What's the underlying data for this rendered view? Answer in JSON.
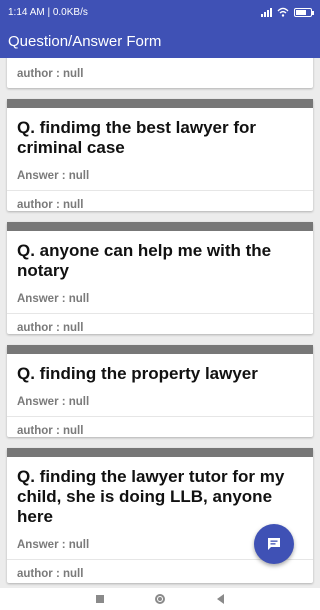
{
  "status_bar": {
    "time_info": "1:14 AM | 0.0KB/s",
    "battery_level": 0.6
  },
  "app_bar": {
    "title": "Question/Answer Form"
  },
  "top_partial_card": {
    "author": "author : null"
  },
  "cards": [
    {
      "question": "Q. findimg the best lawyer for criminal case",
      "answer": "Answer : null",
      "author": "author : null"
    },
    {
      "question": "Q. anyone can help me with the notary",
      "answer": "Answer : null",
      "author": "author : null"
    },
    {
      "question": "Q. finding the property lawyer",
      "answer": "Answer : null",
      "author": "author : null"
    },
    {
      "question": "Q. finding the lawyer tutor for my child, she is doing LLB, anyone here",
      "answer": "Answer : null",
      "author": "author : null"
    }
  ],
  "fab": {
    "icon": "chat-icon"
  },
  "colors": {
    "primary": "#3f51b5",
    "card_header": "#777777",
    "list_bg": "#ececec"
  }
}
